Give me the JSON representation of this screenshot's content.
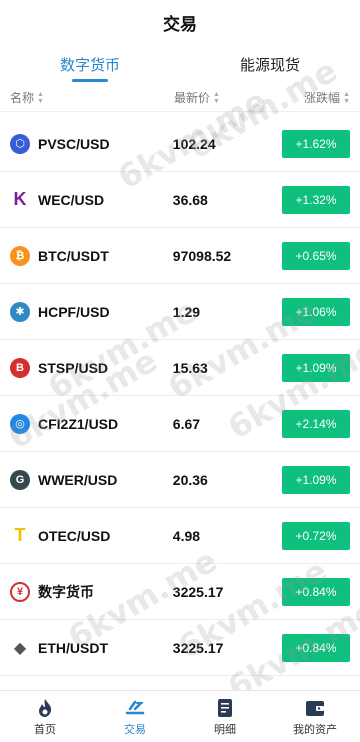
{
  "header": {
    "title": "交易"
  },
  "tabs": [
    {
      "label": "数字货币",
      "active": true
    },
    {
      "label": "能源现货",
      "active": false
    }
  ],
  "columns": {
    "name": "名称",
    "price": "最新价",
    "change": "涨跌幅"
  },
  "rows": [
    {
      "name": "PVSC/USD",
      "price": "102.24",
      "change": "+1.62%",
      "icon": "hexagon-icon",
      "icon_color": "#3a5bd9"
    },
    {
      "name": "WEC/USD",
      "price": "36.68",
      "change": "+1.32%",
      "icon": "k-logo-icon",
      "icon_color": "#7b1fa2"
    },
    {
      "name": "BTC/USDT",
      "price": "97098.52",
      "change": "+0.65%",
      "icon": "bitcoin-icon",
      "icon_color": "#f7931a"
    },
    {
      "name": "HCPF/USD",
      "price": "1.29",
      "change": "+1.06%",
      "icon": "seal-icon",
      "icon_color": "#2f89c5"
    },
    {
      "name": "STSP/USD",
      "price": "15.63",
      "change": "+1.09%",
      "icon": "shield-icon",
      "icon_color": "#d32f2f"
    },
    {
      "name": "CFI2Z1/USD",
      "price": "6.67",
      "change": "+2.14%",
      "icon": "ring-coin-icon",
      "icon_color": "#1e88e5"
    },
    {
      "name": "WWER/USD",
      "price": "20.36",
      "change": "+1.09%",
      "icon": "g-logo-icon",
      "icon_color": "#37474f"
    },
    {
      "name": "OTEC/USD",
      "price": "4.98",
      "change": "+0.72%",
      "icon": "t-logo-icon",
      "icon_color": "#f2c200"
    },
    {
      "name": "数字货币",
      "price": "3225.17",
      "change": "+0.84%",
      "icon": "yuan-icon",
      "icon_color": "#d32f2f"
    },
    {
      "name": "ETH/USDT",
      "price": "3225.17",
      "change": "+0.84%",
      "icon": "ethereum-icon",
      "icon_color": "#555555"
    }
  ],
  "colors": {
    "accent": "#2a86c8",
    "up": "#0fbf7e"
  },
  "watermark": "6kvm.me",
  "nav": [
    {
      "label": "首页",
      "icon": "flame-icon",
      "active": false
    },
    {
      "label": "交易",
      "icon": "trade-icon",
      "active": true
    },
    {
      "label": "明细",
      "icon": "document-icon",
      "active": false
    },
    {
      "label": "我的资产",
      "icon": "wallet-icon",
      "active": false
    }
  ]
}
